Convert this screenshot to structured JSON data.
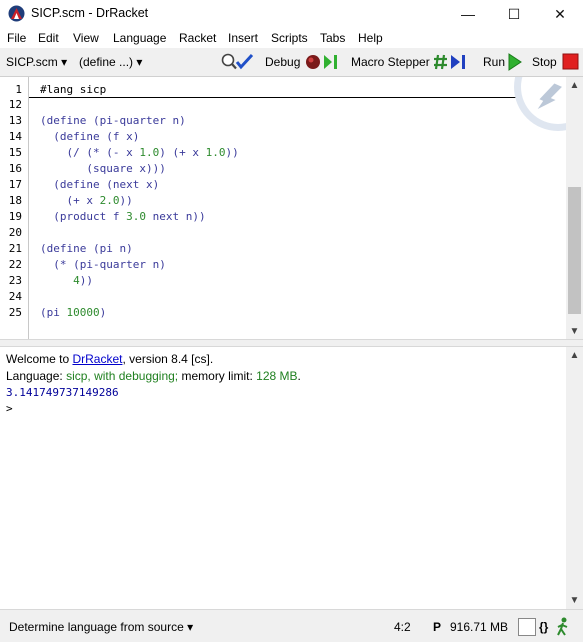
{
  "window": {
    "title": "SICP.scm - DrRacket",
    "minimize_glyph": "—",
    "maximize_glyph": "☐",
    "close_glyph": "✕"
  },
  "menu": {
    "items": [
      "File",
      "Edit",
      "View",
      "Language",
      "Racket",
      "Insert",
      "Scripts",
      "Tabs",
      "Help"
    ]
  },
  "toolbar": {
    "file_button": "SICP.scm",
    "define_menu": "(define ...)",
    "debug_label": "Debug",
    "macro_stepper_label": "Macro Stepper",
    "run_label": "Run",
    "stop_label": "Stop",
    "icons": {
      "check_syntax": "magnifier-check-icon",
      "debug": "bug-icon",
      "macro_stepper": "hash-step-icon",
      "run": "run-triangle-icon",
      "stop": "stop-square-icon"
    }
  },
  "editor": {
    "line_numbers": [
      "1",
      "12",
      "13",
      "14",
      "15",
      "16",
      "17",
      "18",
      "19",
      "20",
      "21",
      "22",
      "23",
      "24",
      "25"
    ],
    "lines": [
      "#lang sicp",
      "",
      "(define (pi-quarter n)",
      "  (define (f x)",
      "    (/ (* (- x 1.0) (+ x 1.0))",
      "       (square x)))",
      "  (define (next x)",
      "    (+ x 2.0))",
      "  (product f 3.0 next n))",
      "",
      "(define (pi n)",
      "  (* (pi-quarter n)",
      "     4))",
      "",
      "(pi 10000)"
    ]
  },
  "interactions": {
    "welcome_prefix": "Welcome to ",
    "welcome_link": "DrRacket",
    "welcome_suffix": ", version 8.4 [cs].",
    "language_prefix": "Language: ",
    "language_value": "sicp, with debugging;",
    "memory_prefix": " memory limit: ",
    "memory_value": "128 MB",
    "memory_suffix": ".",
    "result": "3.141749737149286",
    "prompt": ">"
  },
  "status": {
    "language_selector": "Determine language from source",
    "position": "4:2",
    "memory_label": "P",
    "memory_usage": "916.71 MB",
    "braces_glyph": "{}"
  },
  "colors": {
    "code_text": "#3a3a9a",
    "number_literal": "#2e8b2e",
    "link": "#0000cc",
    "language_green": "#208020",
    "output_blue": "#000099",
    "stop_red": "#e02020",
    "run_green": "#30b030"
  }
}
